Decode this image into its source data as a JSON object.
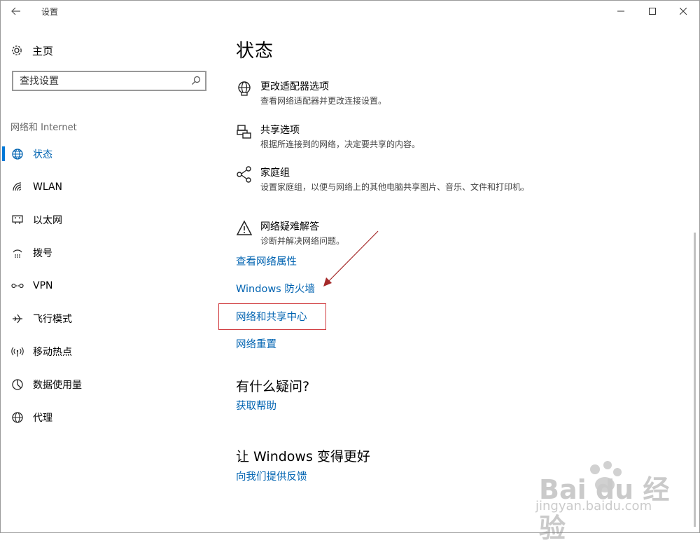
{
  "window": {
    "title": "设置"
  },
  "sidebar": {
    "home_label": "主页",
    "search_placeholder": "查找设置",
    "section_label": "网络和 Internet",
    "items": [
      {
        "label": "状态",
        "icon": "globe-status-icon",
        "active": true
      },
      {
        "label": "WLAN",
        "icon": "wifi-icon"
      },
      {
        "label": "以太网",
        "icon": "ethernet-icon"
      },
      {
        "label": "拨号",
        "icon": "dialup-icon"
      },
      {
        "label": "VPN",
        "icon": "vpn-icon"
      },
      {
        "label": "飞行模式",
        "icon": "airplane-icon"
      },
      {
        "label": "移动热点",
        "icon": "hotspot-icon"
      },
      {
        "label": "数据使用量",
        "icon": "data-usage-icon"
      },
      {
        "label": "代理",
        "icon": "proxy-globe-icon"
      }
    ]
  },
  "main": {
    "title": "状态",
    "options": [
      {
        "title": "更改适配器选项",
        "desc": "查看网络适配器并更改连接设置。",
        "icon": "adapter-globe-icon"
      },
      {
        "title": "共享选项",
        "desc": "根据所连接到的网络，决定要共享的内容。",
        "icon": "sharing-icon"
      },
      {
        "title": "家庭组",
        "desc": "设置家庭组，以便与网络上的其他电脑共享图片、音乐、文件和打印机。",
        "icon": "homegroup-icon"
      },
      {
        "title": "网络疑难解答",
        "desc": "诊断并解决网络问题。",
        "icon": "warning-icon"
      }
    ],
    "links": [
      "查看网络属性",
      "Windows 防火墙",
      "网络和共享中心",
      "网络重置"
    ],
    "help_heading": "有什么疑问?",
    "help_link": "获取帮助",
    "feedback_heading": "让 Windows 变得更好",
    "feedback_link": "向我们提供反馈"
  },
  "watermark": {
    "main": "Bai du 经验",
    "sub": "jingyan.baidu.com"
  },
  "colors": {
    "accent": "#0078d7",
    "link": "#0063b1",
    "annotation": "#d0393d"
  }
}
